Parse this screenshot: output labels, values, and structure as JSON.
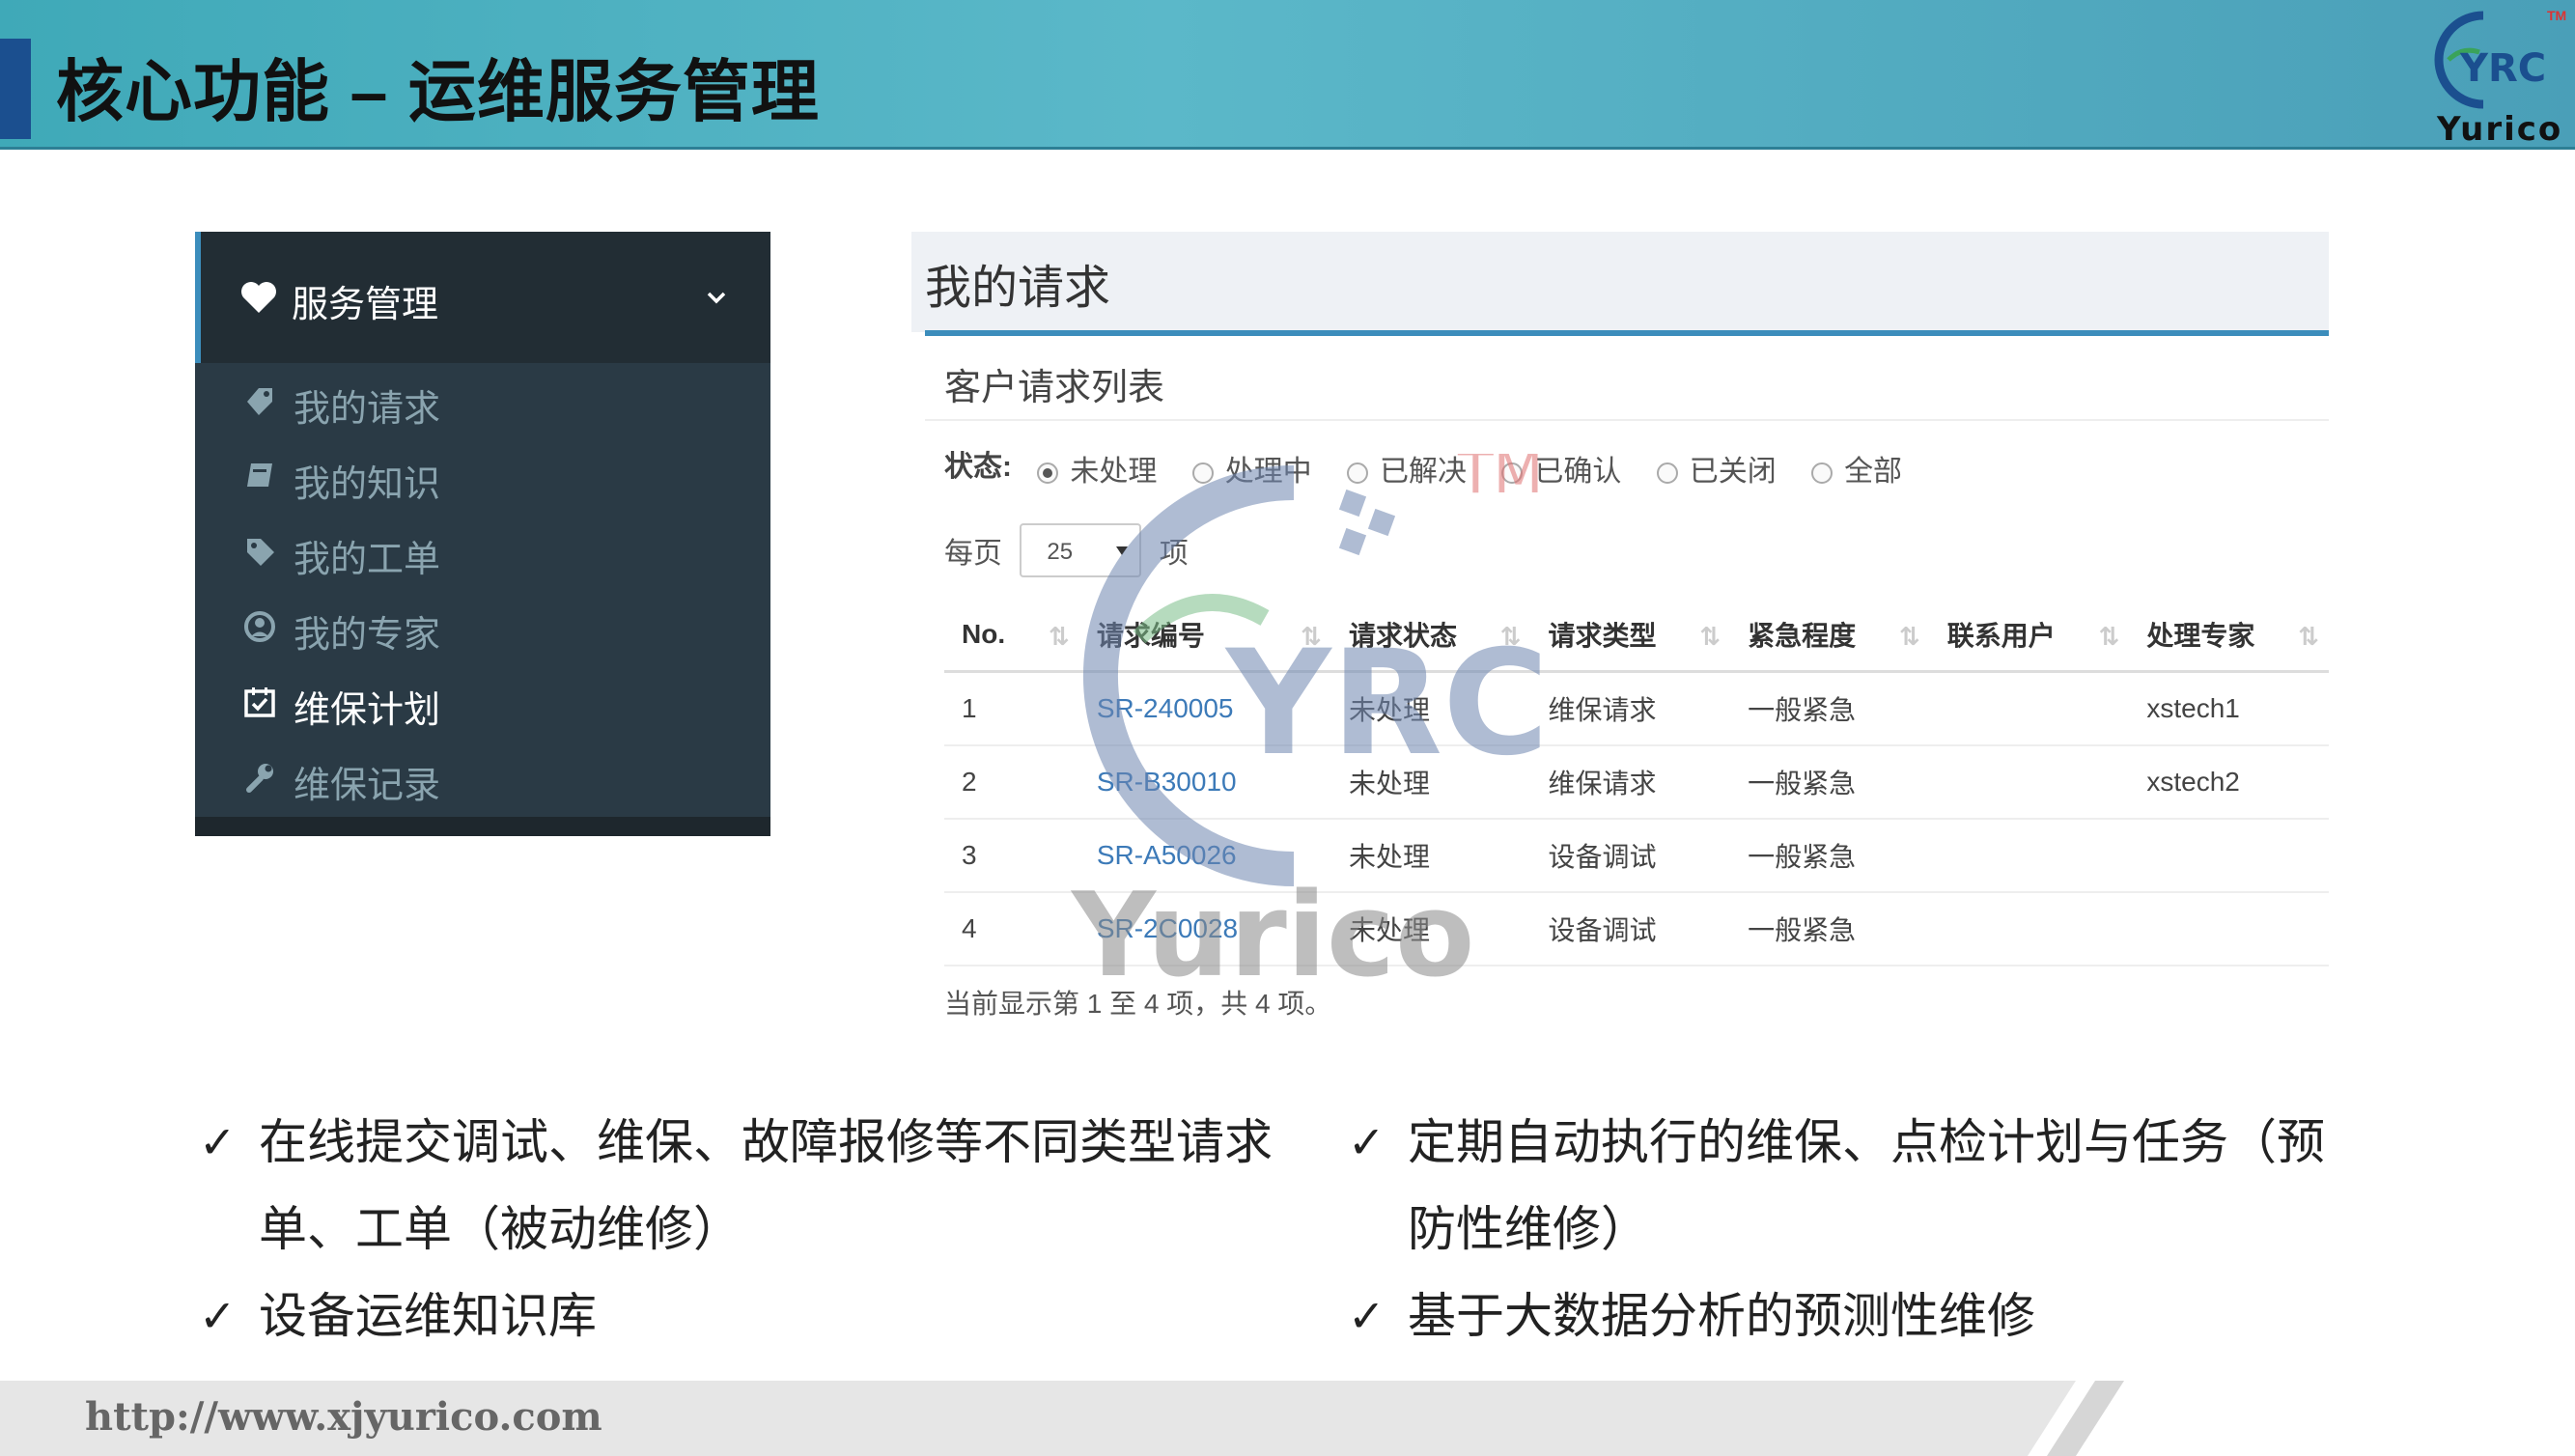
{
  "header": {
    "title": "核心功能 – 运维服务管理",
    "logo_text": "Yurico",
    "logo_mark": "YRC",
    "logo_tm": "TM"
  },
  "sidebar": {
    "group_label": "服务管理",
    "group_icon": "heart-icon",
    "items": [
      {
        "label": "我的请求",
        "icon": "tag-icon",
        "active": false
      },
      {
        "label": "我的知识",
        "icon": "book-icon",
        "active": false
      },
      {
        "label": "我的工单",
        "icon": "label-icon",
        "active": false
      },
      {
        "label": "我的专家",
        "icon": "user-circle-icon",
        "active": false
      },
      {
        "label": "维保计划",
        "icon": "calendar-check-icon",
        "active": true
      },
      {
        "label": "维保记录",
        "icon": "wrench-icon",
        "active": false
      }
    ]
  },
  "panel": {
    "title": "我的请求",
    "box_title": "客户请求列表",
    "status_label": "状态:",
    "status_options": [
      "未处理",
      "处理中",
      "已解决",
      "已确认",
      "已关闭",
      "全部"
    ],
    "status_selected": "未处理",
    "length_prefix": "每页",
    "length_value": "25",
    "length_suffix": "项",
    "columns": [
      "No.",
      "请求编号",
      "请求状态",
      "请求类型",
      "紧急程度",
      "联系用户",
      "处理专家"
    ],
    "rows": [
      [
        "1",
        "SR-240005",
        "未处理",
        "维保请求",
        "一般紧急",
        "",
        "xstech1"
      ],
      [
        "2",
        "SR-B30010",
        "未处理",
        "维保请求",
        "一般紧急",
        "",
        "xstech2"
      ],
      [
        "3",
        "SR-A50026",
        "未处理",
        "设备调试",
        "一般紧急",
        "",
        ""
      ],
      [
        "4",
        "SR-2C0028",
        "未处理",
        "设备调试",
        "一般紧急",
        "",
        ""
      ]
    ],
    "info": "当前显示第 1 至 4 项，共 4 项。"
  },
  "watermark": {
    "mark": "YRC",
    "word": "Yurico",
    "tm": "TM"
  },
  "bullets": {
    "left": [
      "在线提交调试、维保、故障报修等不同类型请求单、工单（被动维修）",
      "设备运维知识库"
    ],
    "right": [
      "定期自动执行的维保、点检计划与任务（预防性维修）",
      "基于大数据分析的预测性维修"
    ],
    "check": "✓"
  },
  "footer": {
    "url": "http://www.xjyurico.com"
  },
  "colors": {
    "accent": "#3c8dbc",
    "header": "#5bb8c9",
    "sidebar": "#2a3a45",
    "link": "#3c7ab8"
  }
}
